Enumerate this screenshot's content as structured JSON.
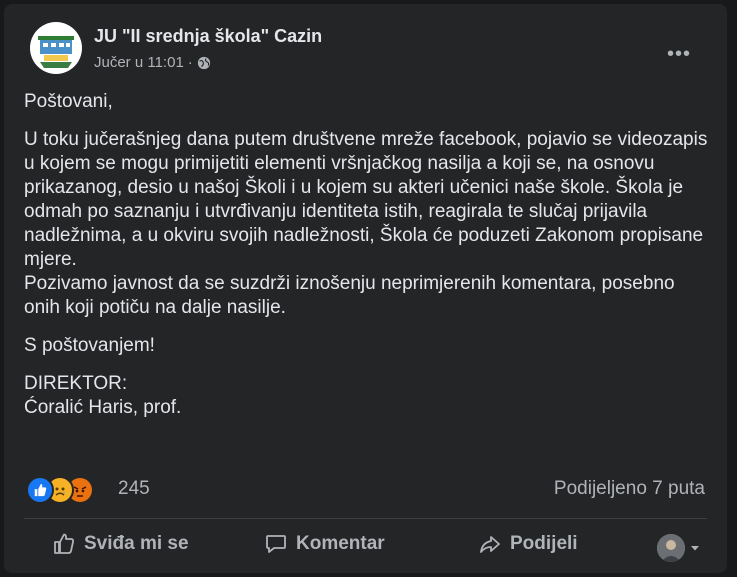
{
  "post": {
    "page_name": "JU \"II srednja škola\" Cazin",
    "timestamp": "Jučer u 11:01",
    "separator": "·",
    "privacy_icon": "globe-icon",
    "more_icon": "•••",
    "paragraphs": [
      "Poštovani,",
      "U toku jučerašnjeg dana putem društvene mreže facebook, pojavio se videozapis u kojem se mogu primijetiti elementi vršnjačkog nasilja a koji se, na osnovu prikazanog, desio u našoj Školi i u kojem su akteri učenici naše škole. Škola je odmah po saznanju i utvrđivanju identiteta istih, reagirala te slučaj prijavila nadležnima, a u okviru svojih nadležnosti, Škola će poduzeti Zakonom propisane mjere.",
      "Pozivamo javnost da se suzdrži iznošenju neprimjerenih komentara, posebno onih koji potiču na dalje nasilje.",
      "S poštovanjem!",
      "DIREKTOR:",
      "Ćoralić Haris, prof."
    ]
  },
  "stats": {
    "reaction_icons": [
      "like-icon",
      "sad-icon",
      "angry-icon"
    ],
    "reaction_count": "245",
    "shares_text": "Podijeljeno 7 puta"
  },
  "actions": {
    "like_label": "Sviđa mi se",
    "comment_label": "Komentar",
    "share_label": "Podijeli"
  },
  "colors": {
    "background": "#18191a",
    "card": "#242526",
    "text": "#e4e6eb",
    "secondary_text": "#b0b3b8",
    "like_blue": "#1877f2"
  }
}
